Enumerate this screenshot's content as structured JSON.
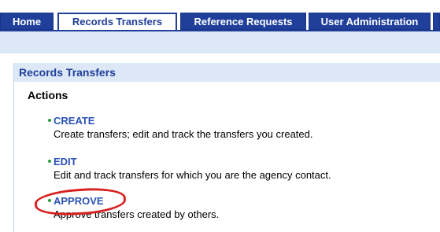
{
  "nav": {
    "tabs": [
      {
        "label": "Home"
      },
      {
        "label": "Records Transfers"
      },
      {
        "label": "Reference Requests"
      },
      {
        "label": "User Administration"
      }
    ],
    "active_tab": "Records Transfers"
  },
  "panel": {
    "title": "Records Transfers",
    "actions_heading": "Actions",
    "items": [
      {
        "label": "CREATE",
        "description": "Create transfers; edit and track the transfers you created."
      },
      {
        "label": "EDIT",
        "description": "Edit and track transfers for which you are the agency contact."
      },
      {
        "label": "APPROVE",
        "description": "Approve transfers created by others."
      }
    ]
  },
  "colors": {
    "nav_blue": "#1f3f9a",
    "light_blue": "#dde8f6",
    "link_blue": "#2a53b5",
    "bullet_green": "#2e9b3c",
    "highlight_red": "#d92020"
  }
}
